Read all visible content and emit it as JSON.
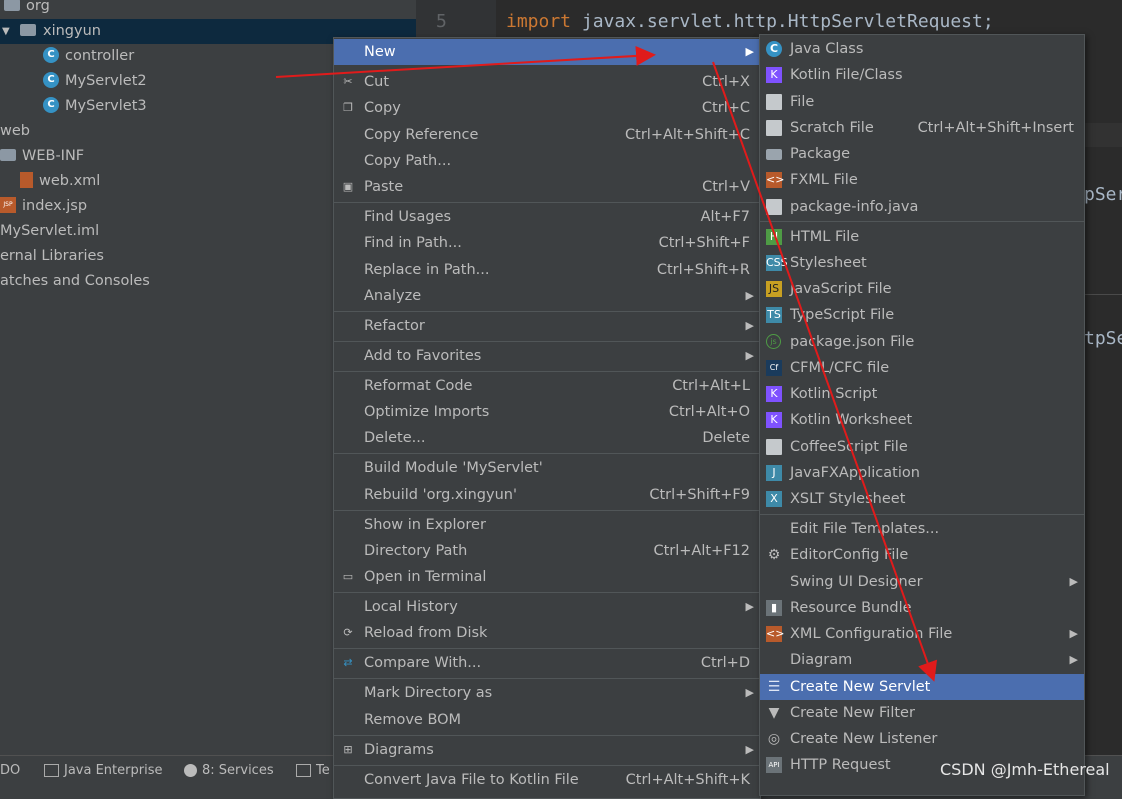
{
  "project_tree": {
    "items": [
      {
        "label": "org"
      },
      {
        "label": "xingyun"
      },
      {
        "label": "controller"
      },
      {
        "label": "MyServlet2"
      },
      {
        "label": "MyServlet3"
      },
      {
        "label": "web"
      },
      {
        "label": "WEB-INF"
      },
      {
        "label": "web.xml"
      },
      {
        "label": "index.jsp"
      },
      {
        "label": "MyServlet.iml"
      },
      {
        "label": "ernal Libraries"
      },
      {
        "label": "atches and Consoles"
      }
    ]
  },
  "editor": {
    "line_number": "5",
    "line_text_kw": "import",
    "line_text_rest": " javax.servlet.http.HttpServletRequest;",
    "right_frag_1": "pSer",
    "right_frag_2": "tpSe"
  },
  "context_menu": {
    "items": [
      {
        "label": "New"
      },
      {
        "label": "Cut",
        "shortcut": "Ctrl+X"
      },
      {
        "label": "Copy",
        "shortcut": "Ctrl+C"
      },
      {
        "label": "Copy Reference",
        "shortcut": "Ctrl+Alt+Shift+C"
      },
      {
        "label": "Copy Path...",
        "shortcut": ""
      },
      {
        "label": "Paste",
        "shortcut": "Ctrl+V"
      },
      {
        "label": "Find Usages",
        "shortcut": "Alt+F7"
      },
      {
        "label": "Find in Path...",
        "shortcut": "Ctrl+Shift+F"
      },
      {
        "label": "Replace in Path...",
        "shortcut": "Ctrl+Shift+R"
      },
      {
        "label": "Analyze"
      },
      {
        "label": "Refactor"
      },
      {
        "label": "Add to Favorites"
      },
      {
        "label": "Reformat Code",
        "shortcut": "Ctrl+Alt+L"
      },
      {
        "label": "Optimize Imports",
        "shortcut": "Ctrl+Alt+O"
      },
      {
        "label": "Delete...",
        "shortcut": "Delete"
      },
      {
        "label": "Build Module 'MyServlet'",
        "shortcut": ""
      },
      {
        "label": "Rebuild 'org.xingyun'",
        "shortcut": "Ctrl+Shift+F9"
      },
      {
        "label": "Show in Explorer",
        "shortcut": ""
      },
      {
        "label": "Directory Path",
        "shortcut": "Ctrl+Alt+F12"
      },
      {
        "label": "Open in Terminal",
        "shortcut": ""
      },
      {
        "label": "Local History"
      },
      {
        "label": "Reload from Disk",
        "shortcut": ""
      },
      {
        "label": "Compare With...",
        "shortcut": "Ctrl+D"
      },
      {
        "label": "Mark Directory as"
      },
      {
        "label": "Remove BOM",
        "shortcut": ""
      },
      {
        "label": "Diagrams"
      },
      {
        "label": "Convert Java File to Kotlin File",
        "shortcut": "Ctrl+Alt+Shift+K"
      }
    ]
  },
  "new_submenu": {
    "items": [
      {
        "label": "Java Class"
      },
      {
        "label": "Kotlin File/Class"
      },
      {
        "label": "File"
      },
      {
        "label": "Scratch File",
        "shortcut": "Ctrl+Alt+Shift+Insert"
      },
      {
        "label": "Package"
      },
      {
        "label": "FXML File"
      },
      {
        "label": "package-info.java"
      },
      {
        "label": "HTML File"
      },
      {
        "label": "Stylesheet"
      },
      {
        "label": "JavaScript File"
      },
      {
        "label": "TypeScript File"
      },
      {
        "label": "package.json File"
      },
      {
        "label": "CFML/CFC file"
      },
      {
        "label": "Kotlin Script"
      },
      {
        "label": "Kotlin Worksheet"
      },
      {
        "label": "CoffeeScript File"
      },
      {
        "label": "JavaFXApplication"
      },
      {
        "label": "XSLT Stylesheet"
      },
      {
        "label": "Edit File Templates..."
      },
      {
        "label": "EditorConfig File"
      },
      {
        "label": "Swing UI Designer"
      },
      {
        "label": "Resource Bundle"
      },
      {
        "label": "XML Configuration File"
      },
      {
        "label": "Diagram"
      },
      {
        "label": "Create New Servlet"
      },
      {
        "label": "Create New Filter"
      },
      {
        "label": "Create New Listener"
      },
      {
        "label": "HTTP Request"
      }
    ]
  },
  "bottom_bar": {
    "todo": "DO",
    "java_enterprise": "Java Enterprise",
    "services": "8: Services",
    "terminal": "Te"
  },
  "icon_text": {
    "class_icon": "C",
    "jsp_icon": "JSP",
    "html_icon": "H",
    "css_icon": "CSS",
    "js_icon": "JS",
    "ts_icon": "TS",
    "cf_icon": "Cf",
    "api_icon": "API"
  },
  "watermark": "CSDN @Jmh-Ethereal",
  "colors": {
    "highlight": "#4b6eaf",
    "menu_bg": "#3c3f41",
    "editor_bg": "#2b2b2b",
    "annotation_arrow": "#e01b1b"
  }
}
